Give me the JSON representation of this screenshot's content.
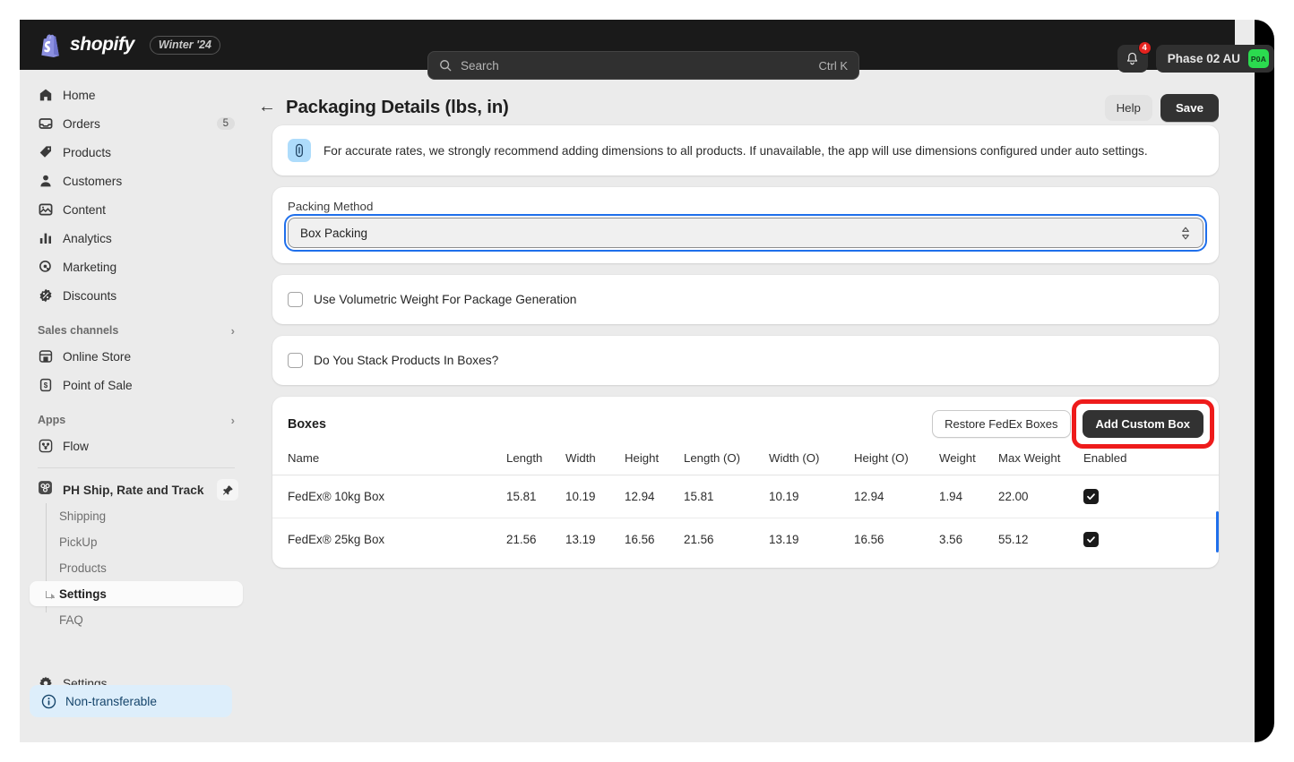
{
  "topbar": {
    "brand_word": "shopify",
    "season_badge": "Winter '24",
    "search_placeholder": "Search",
    "search_shortcut": "Ctrl K",
    "notification_count": "4",
    "account_name": "Phase 02 AU",
    "account_initials": "P0A"
  },
  "sidebar": {
    "items": [
      {
        "label": "Home",
        "icon": "home-icon",
        "count": ""
      },
      {
        "label": "Orders",
        "icon": "orders-icon",
        "count": "5"
      },
      {
        "label": "Products",
        "icon": "products-tag-icon",
        "count": ""
      },
      {
        "label": "Customers",
        "icon": "customers-person-icon",
        "count": ""
      },
      {
        "label": "Content",
        "icon": "content-image-icon",
        "count": ""
      },
      {
        "label": "Analytics",
        "icon": "analytics-bars-icon",
        "count": ""
      },
      {
        "label": "Marketing",
        "icon": "marketing-target-icon",
        "count": ""
      },
      {
        "label": "Discounts",
        "icon": "discounts-badge-icon",
        "count": ""
      }
    ],
    "sections": {
      "sales_channels": "Sales channels",
      "apps": "Apps"
    },
    "channels": [
      {
        "label": "Online Store",
        "icon": "store-icon"
      },
      {
        "label": "Point of Sale",
        "icon": "pos-icon"
      }
    ],
    "apps": [
      {
        "label": "Flow",
        "icon": "flow-icon"
      }
    ],
    "active_app": {
      "label": "PH Ship, Rate and Track",
      "icon": "app-icon",
      "pin_icon": "pin-icon",
      "sub_items": [
        {
          "label": "Shipping",
          "active": false
        },
        {
          "label": "PickUp",
          "active": false
        },
        {
          "label": "Products",
          "active": false
        },
        {
          "label": "Settings",
          "active": true
        },
        {
          "label": "FAQ",
          "active": false
        }
      ]
    },
    "settings": {
      "label": "Settings",
      "icon": "gear-icon"
    },
    "footer_banner": {
      "label": "Non-transferable",
      "icon": "info-circle-icon"
    }
  },
  "main": {
    "back_icon": "back-arrow-icon",
    "title": "Packaging Details (lbs, in)",
    "help_label": "Help",
    "save_label": "Save",
    "info_banner": {
      "icon": "info-icon",
      "text": "For accurate rates, we strongly recommend adding dimensions to all products. If unavailable, the app will use dimensions configured under auto settings."
    },
    "packing_method": {
      "label": "Packing Method",
      "value": "Box Packing",
      "chevron_icon": "chevron-updown-icon"
    },
    "checkboxes": [
      {
        "label": "Use Volumetric Weight For Package Generation",
        "checked": false
      },
      {
        "label": "Do You Stack Products In Boxes?",
        "checked": false
      }
    ],
    "boxes": {
      "title": "Boxes",
      "restore_label": "Restore FedEx Boxes",
      "add_label": "Add Custom Box",
      "columns": [
        "Name",
        "Length",
        "Width",
        "Height",
        "Length (O)",
        "Width (O)",
        "Height (O)",
        "Weight",
        "Max Weight",
        "Enabled"
      ],
      "rows": [
        {
          "name": "FedEx® 10kg Box",
          "length": "15.81",
          "width": "10.19",
          "height": "12.94",
          "length_o": "15.81",
          "width_o": "10.19",
          "height_o": "12.94",
          "weight": "1.94",
          "max_weight": "22.00",
          "enabled": true
        },
        {
          "name": "FedEx® 25kg Box",
          "length": "21.56",
          "width": "13.19",
          "height": "16.56",
          "length_o": "21.56",
          "width_o": "13.19",
          "height_o": "16.56",
          "weight": "3.56",
          "max_weight": "55.12",
          "enabled": true
        }
      ]
    }
  },
  "colors": {
    "accent_blue": "#1f6feb",
    "annotation_red": "#ee1b1b",
    "topbar_bg": "#1a1a1a",
    "avatar_green": "#2bdb4f"
  }
}
